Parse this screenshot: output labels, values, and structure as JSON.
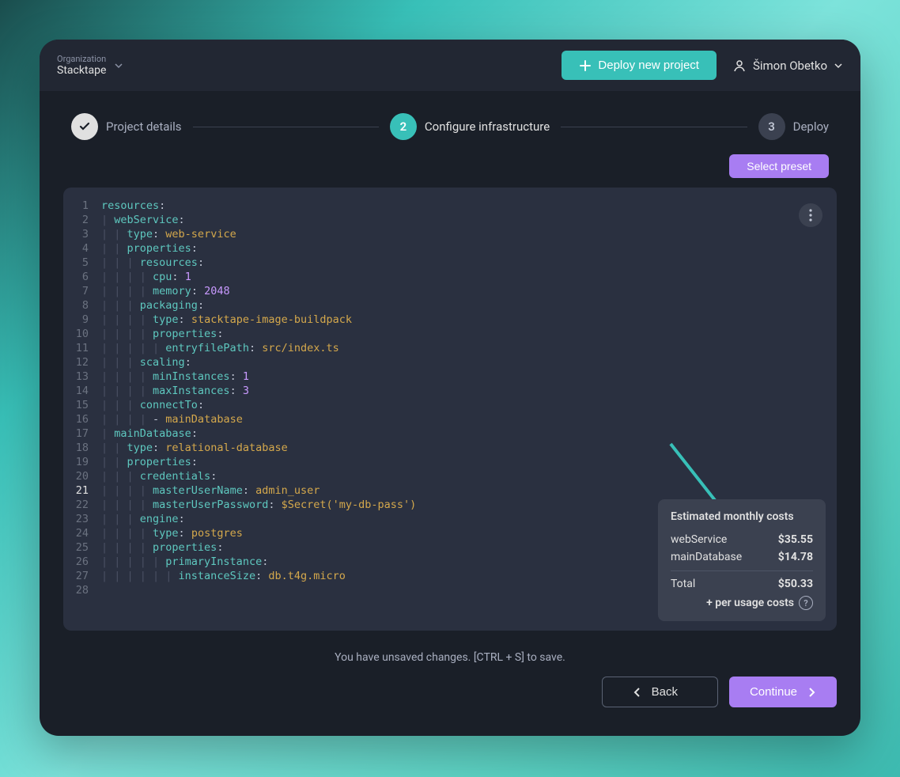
{
  "header": {
    "org_label": "Organization",
    "org_name": "Stacktape",
    "deploy_label": "Deploy new project",
    "user_name": "Šimon Obetko"
  },
  "wizard": {
    "step1": "Project details",
    "step2_num": "2",
    "step2": "Configure infrastructure",
    "step3_num": "3",
    "step3": "Deploy"
  },
  "actions": {
    "select_preset": "Select preset"
  },
  "editor": {
    "unsaved_message": "You have unsaved changes.  [CTRL  +  S]  to save.",
    "current_line": 21,
    "code_lines": [
      {
        "n": 1,
        "indent": 0,
        "tokens": [
          [
            "key",
            "resources"
          ],
          [
            "punc",
            ":"
          ]
        ]
      },
      {
        "n": 2,
        "indent": 1,
        "tokens": [
          [
            "key",
            "webService"
          ],
          [
            "punc",
            ":"
          ]
        ]
      },
      {
        "n": 3,
        "indent": 2,
        "tokens": [
          [
            "key",
            "type"
          ],
          [
            "punc",
            ": "
          ],
          [
            "str",
            "web-service"
          ]
        ]
      },
      {
        "n": 4,
        "indent": 2,
        "tokens": [
          [
            "key",
            "properties"
          ],
          [
            "punc",
            ":"
          ]
        ]
      },
      {
        "n": 5,
        "indent": 3,
        "tokens": [
          [
            "key",
            "resources"
          ],
          [
            "punc",
            ":"
          ]
        ]
      },
      {
        "n": 6,
        "indent": 4,
        "tokens": [
          [
            "key",
            "cpu"
          ],
          [
            "punc",
            ": "
          ],
          [
            "num",
            "1"
          ]
        ]
      },
      {
        "n": 7,
        "indent": 4,
        "tokens": [
          [
            "key",
            "memory"
          ],
          [
            "punc",
            ": "
          ],
          [
            "num",
            "2048"
          ]
        ]
      },
      {
        "n": 8,
        "indent": 3,
        "tokens": [
          [
            "key",
            "packaging"
          ],
          [
            "punc",
            ":"
          ]
        ]
      },
      {
        "n": 9,
        "indent": 4,
        "tokens": [
          [
            "key",
            "type"
          ],
          [
            "punc",
            ": "
          ],
          [
            "str",
            "stacktape-image-buildpack"
          ]
        ]
      },
      {
        "n": 10,
        "indent": 4,
        "tokens": [
          [
            "key",
            "properties"
          ],
          [
            "punc",
            ":"
          ]
        ]
      },
      {
        "n": 11,
        "indent": 5,
        "tokens": [
          [
            "key",
            "entryfilePath"
          ],
          [
            "punc",
            ": "
          ],
          [
            "str",
            "src/index.ts"
          ]
        ]
      },
      {
        "n": 12,
        "indent": 3,
        "tokens": [
          [
            "key",
            "scaling"
          ],
          [
            "punc",
            ":"
          ]
        ]
      },
      {
        "n": 13,
        "indent": 4,
        "tokens": [
          [
            "key",
            "minInstances"
          ],
          [
            "punc",
            ": "
          ],
          [
            "num",
            "1"
          ]
        ]
      },
      {
        "n": 14,
        "indent": 4,
        "tokens": [
          [
            "key",
            "maxInstances"
          ],
          [
            "punc",
            ": "
          ],
          [
            "num",
            "3"
          ]
        ]
      },
      {
        "n": 15,
        "indent": 3,
        "tokens": [
          [
            "key",
            "connectTo"
          ],
          [
            "punc",
            ":"
          ]
        ]
      },
      {
        "n": 16,
        "indent": 4,
        "tokens": [
          [
            "punc",
            "- "
          ],
          [
            "str",
            "mainDatabase"
          ]
        ]
      },
      {
        "n": 17,
        "indent": 1,
        "tokens": [
          [
            "key",
            "mainDatabase"
          ],
          [
            "punc",
            ":"
          ]
        ]
      },
      {
        "n": 18,
        "indent": 2,
        "tokens": [
          [
            "key",
            "type"
          ],
          [
            "punc",
            ": "
          ],
          [
            "str",
            "relational-database"
          ]
        ]
      },
      {
        "n": 19,
        "indent": 2,
        "tokens": [
          [
            "key",
            "properties"
          ],
          [
            "punc",
            ":"
          ]
        ]
      },
      {
        "n": 20,
        "indent": 3,
        "tokens": [
          [
            "key",
            "credentials"
          ],
          [
            "punc",
            ":"
          ]
        ]
      },
      {
        "n": 21,
        "indent": 4,
        "tokens": [
          [
            "key",
            "masterUserName"
          ],
          [
            "punc",
            ": "
          ],
          [
            "str",
            "admin_user"
          ]
        ]
      },
      {
        "n": 22,
        "indent": 4,
        "tokens": [
          [
            "key",
            "masterUserPassword"
          ],
          [
            "punc",
            ": "
          ],
          [
            "str",
            "$Secret('my-db-pass')"
          ]
        ]
      },
      {
        "n": 23,
        "indent": 3,
        "tokens": [
          [
            "key",
            "engine"
          ],
          [
            "punc",
            ":"
          ]
        ]
      },
      {
        "n": 24,
        "indent": 4,
        "tokens": [
          [
            "key",
            "type"
          ],
          [
            "punc",
            ": "
          ],
          [
            "str",
            "postgres"
          ]
        ]
      },
      {
        "n": 25,
        "indent": 4,
        "tokens": [
          [
            "key",
            "properties"
          ],
          [
            "punc",
            ":"
          ]
        ]
      },
      {
        "n": 26,
        "indent": 5,
        "tokens": [
          [
            "key",
            "primaryInstance"
          ],
          [
            "punc",
            ":"
          ]
        ]
      },
      {
        "n": 27,
        "indent": 6,
        "tokens": [
          [
            "key",
            "instanceSize"
          ],
          [
            "punc",
            ": "
          ],
          [
            "str",
            "db.t4g.micro"
          ]
        ]
      },
      {
        "n": 28,
        "indent": 0,
        "tokens": []
      }
    ]
  },
  "costs": {
    "title": "Estimated monthly costs",
    "rows": [
      {
        "label": "webService",
        "value": "$35.55"
      },
      {
        "label": "mainDatabase",
        "value": "$14.78"
      }
    ],
    "total_label": "Total",
    "total_value": "$50.33",
    "usage": "+ per usage costs"
  },
  "footer": {
    "back": "Back",
    "continue": "Continue"
  }
}
